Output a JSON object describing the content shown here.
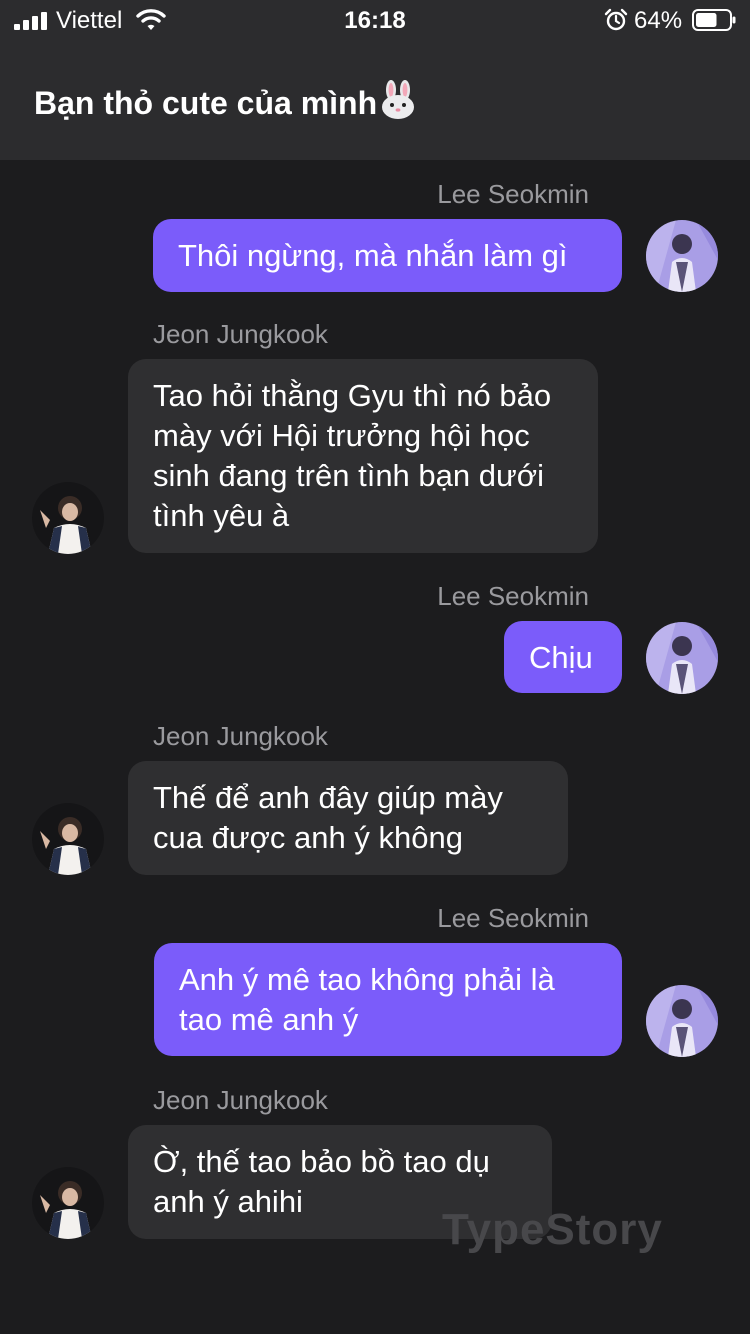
{
  "status_bar": {
    "carrier": "Viettel",
    "time": "16:18",
    "battery_percent": "64%",
    "battery_level": 0.64
  },
  "header": {
    "title": "Bạn thỏ cute của mình",
    "title_emoji": "rabbit-face"
  },
  "messages": [
    {
      "sender": "Lee Seokmin",
      "side": "right",
      "text": "Thôi ngừng, mà nhắn làm gì"
    },
    {
      "sender": "Jeon Jungkook",
      "side": "left",
      "text": "Tao hỏi thằng Gyu thì nó bảo mày với Hội trưởng hội học sinh đang trên tình bạn dưới tình yêu à"
    },
    {
      "sender": "Lee Seokmin",
      "side": "right",
      "text": "Chịu"
    },
    {
      "sender": "Jeon Jungkook",
      "side": "left",
      "text": "Thế để anh đây giúp mày cua được anh ý không"
    },
    {
      "sender": "Lee Seokmin",
      "side": "right",
      "text": "Anh ý mê tao không phải là tao mê anh ý"
    },
    {
      "sender": "Jeon Jungkook",
      "side": "left",
      "text": "Ờ, thế tao bảo bồ tao dụ anh ý ahihi"
    }
  ],
  "watermark": "TypeStory",
  "colors": {
    "outgoing_bubble": "#7b5cfa",
    "incoming_bubble": "#2f2f31",
    "background": "#1c1c1e",
    "header": "#2c2c2e"
  }
}
